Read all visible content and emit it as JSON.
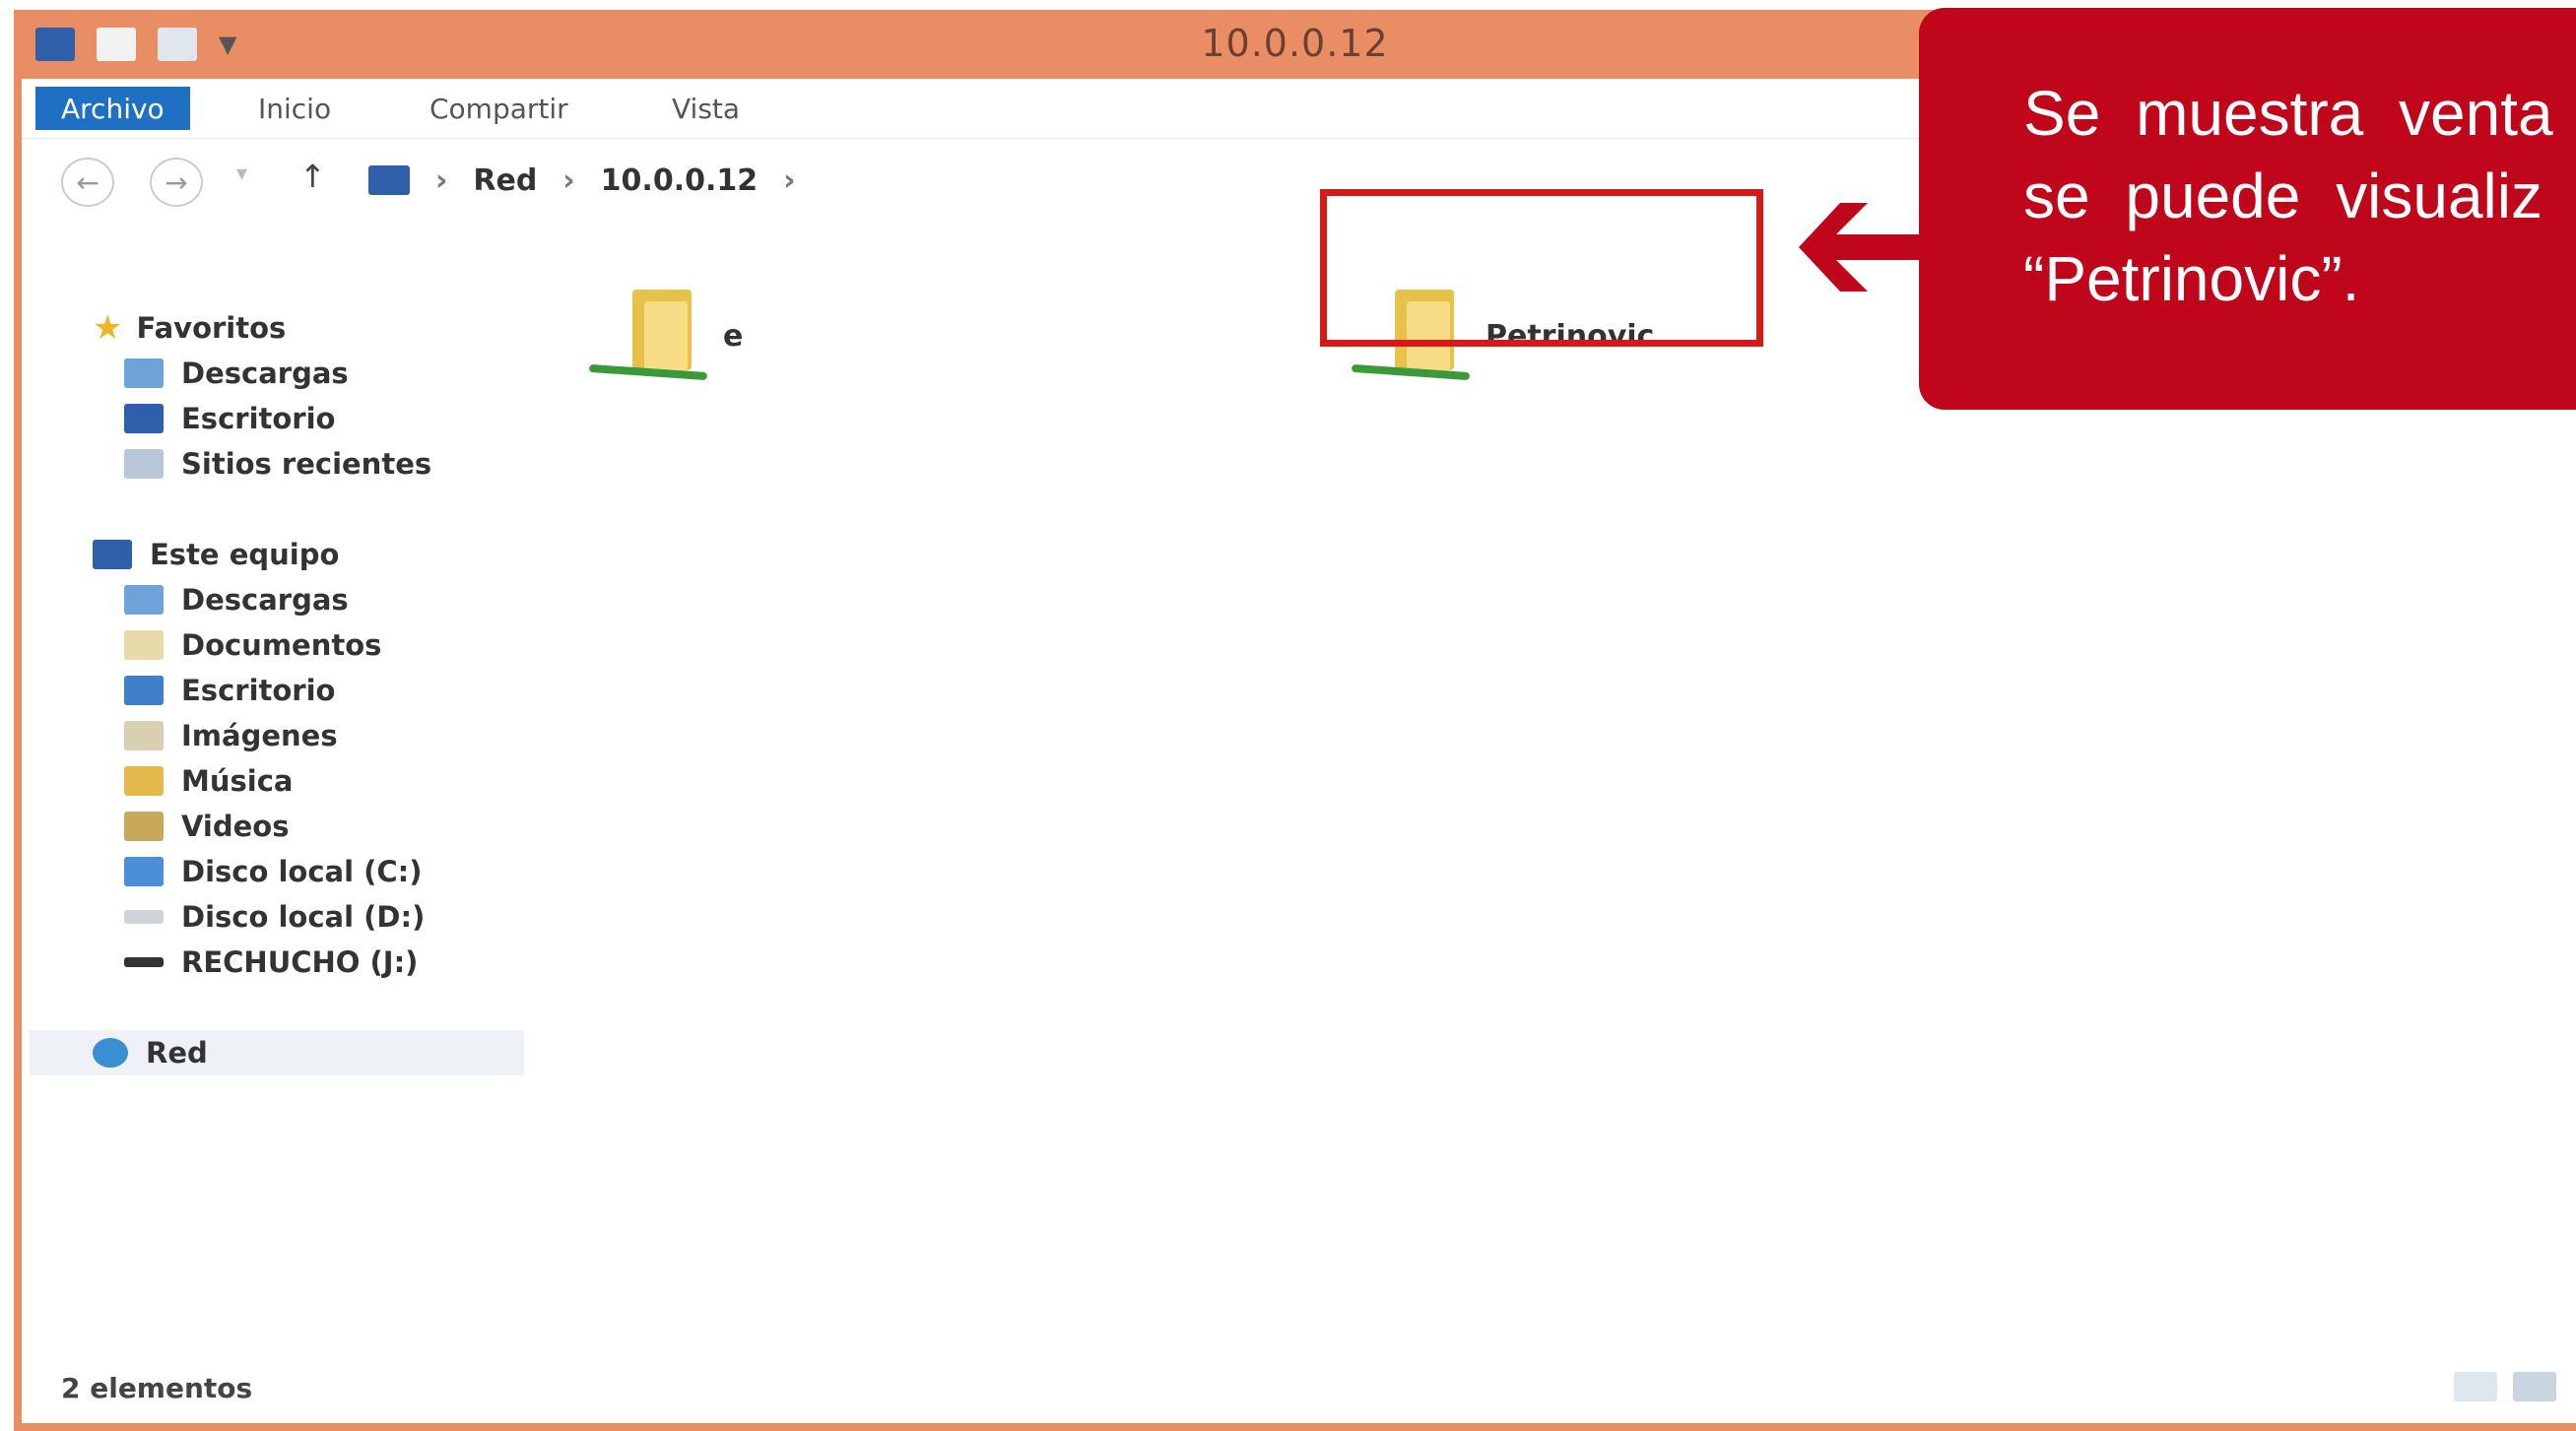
{
  "window": {
    "title": "10.0.0.12"
  },
  "ribbon": {
    "tabs": [
      "Archivo",
      "Inicio",
      "Compartir",
      "Vista"
    ]
  },
  "address": {
    "back_icon": "back-arrow-icon",
    "forward_icon": "forward-arrow-icon",
    "up_icon": "up-arrow-icon",
    "crumbs": [
      "Red",
      "10.0.0.12"
    ]
  },
  "sidebar": {
    "favorites": {
      "label": "Favoritos",
      "items": [
        "Descargas",
        "Escritorio",
        "Sitios recientes"
      ]
    },
    "this_pc": {
      "label": "Este equipo",
      "items": [
        "Descargas",
        "Documentos",
        "Escritorio",
        "Imágenes",
        "Música",
        "Videos",
        "Disco local (C:)",
        "Disco local (D:)",
        "RECHUCHO (J:)"
      ]
    },
    "network": {
      "label": "Red"
    }
  },
  "content": {
    "items": [
      {
        "label": "e",
        "icon": "shared-folder-icon"
      },
      {
        "label": "Petrinovic",
        "icon": "shared-folder-icon"
      }
    ]
  },
  "status": {
    "text": "2 elementos"
  },
  "callout": {
    "lines": [
      "Se muestra venta",
      "se puede visualiz",
      "“Petrinovic”."
    ],
    "color": "#C0061B"
  },
  "colors": {
    "window_frame": "#E98E64",
    "file_tab": "#1f6fc2",
    "highlight": "#d61a1a"
  }
}
